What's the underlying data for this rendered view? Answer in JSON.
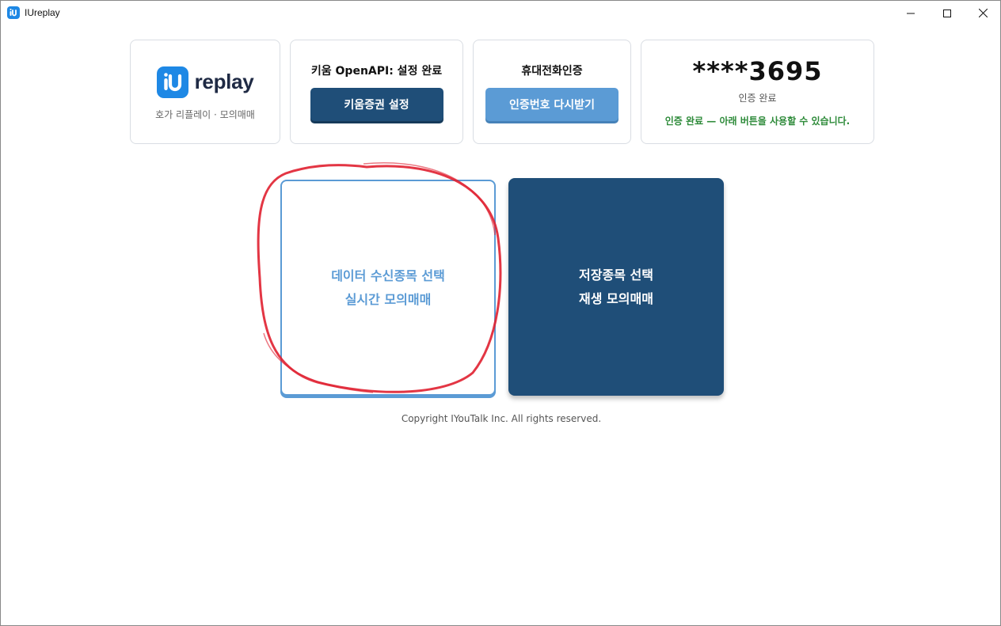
{
  "window": {
    "title": "IUreplay",
    "controls": [
      "minimize",
      "maximize",
      "close"
    ]
  },
  "logo_card": {
    "wordmark": "replay",
    "subtitle": "호가 리플레이 · 모의매매",
    "brand_color": "#1e88e5"
  },
  "kiwoom_card": {
    "title": "키움 OpenAPI: 설정 완료",
    "button_label": "키움증권 설정"
  },
  "phone_card": {
    "title": "휴대전화인증",
    "button_label": "인증번호 다시받기"
  },
  "auth_card": {
    "masked_number": "****3695",
    "status_label": "인증 완료",
    "message": "인증 완료 — 아래 버튼을 사용할 수 있습니다.",
    "message_color": "#2e8b3a"
  },
  "actions": {
    "realtime": {
      "line1": "데이터 수신종목 선택",
      "line2": "실시간 모의매매"
    },
    "replay": {
      "line1": "저장종목 선택",
      "line2": "재생 모의매매"
    }
  },
  "annotation": {
    "type": "red-circle",
    "target": "realtime",
    "color": "#e02030"
  },
  "footer": {
    "copyright": "Copyright IYouTalk Inc. All rights reserved."
  },
  "colors": {
    "primary_dark": "#1f4e78",
    "primary_light": "#5b9bd5"
  }
}
